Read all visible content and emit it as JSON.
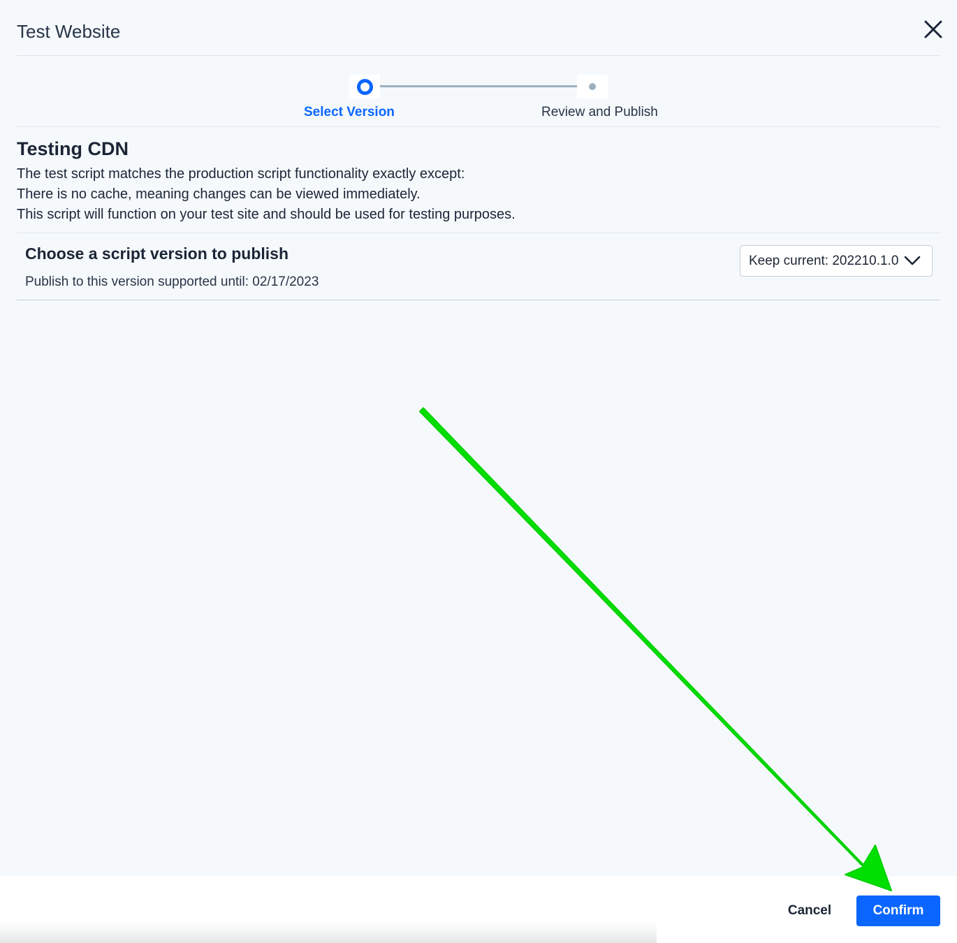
{
  "dialog": {
    "title": "Test Website",
    "close_icon": "close-icon"
  },
  "stepper": {
    "steps": [
      {
        "label": "Select Version",
        "state": "active"
      },
      {
        "label": "Review and Publish",
        "state": "pending"
      }
    ]
  },
  "section": {
    "heading": "Testing CDN",
    "lines": [
      "The test script matches the production script functionality exactly except:",
      "There is no cache, meaning changes can be viewed immediately.",
      "This script will function on your test site and should be used for testing purposes."
    ]
  },
  "version": {
    "heading": "Choose a script version to publish",
    "support_text": "Publish to this version supported until: 02/17/2023",
    "selected": "Keep current: 202210.1.0",
    "chevron_icon": "chevron-down-icon"
  },
  "footer": {
    "cancel_label": "Cancel",
    "confirm_label": "Confirm"
  },
  "annotation": {
    "arrow_icon": "arrow-annotation-icon",
    "color": "#00e000"
  },
  "colors": {
    "accent": "#0a66ff",
    "background": "#f5f9fc",
    "text": "#1b2536",
    "step_line": "#9db0bf"
  }
}
